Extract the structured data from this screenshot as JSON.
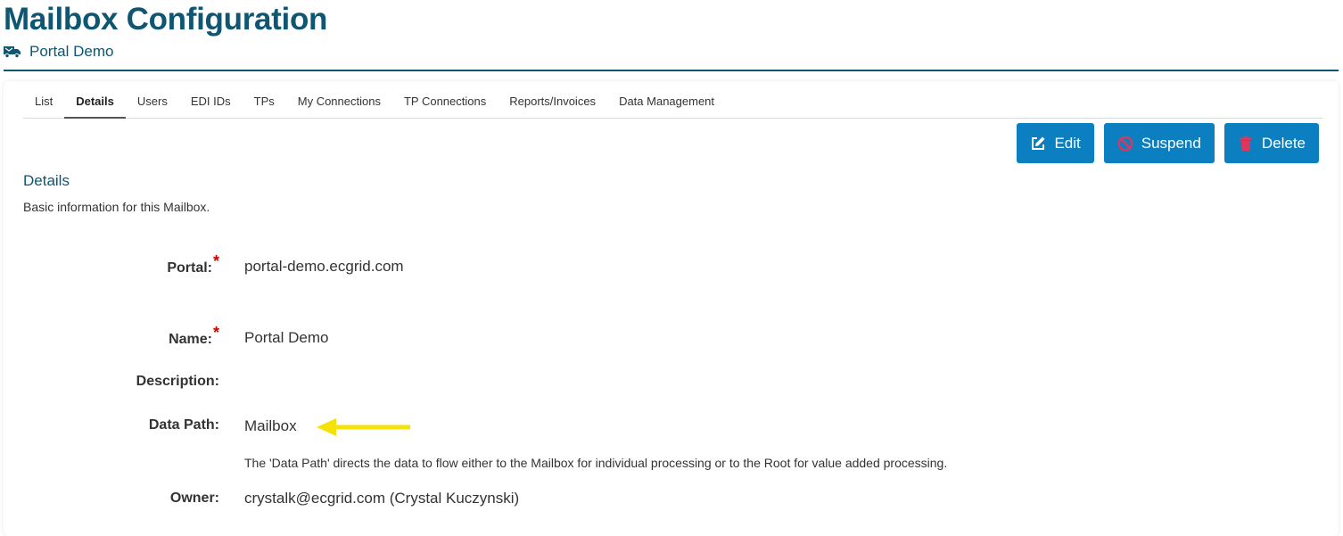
{
  "header": {
    "title": "Mailbox Configuration",
    "subtitle": "Portal Demo",
    "subtitle_icon": "mailbox-truck-icon",
    "accent_color": "#0e5672"
  },
  "tabs": [
    {
      "label": "List",
      "active": false
    },
    {
      "label": "Details",
      "active": true
    },
    {
      "label": "Users",
      "active": false
    },
    {
      "label": "EDI IDs",
      "active": false
    },
    {
      "label": "TPs",
      "active": false
    },
    {
      "label": "My Connections",
      "active": false
    },
    {
      "label": "TP Connections",
      "active": false
    },
    {
      "label": "Reports/Invoices",
      "active": false
    },
    {
      "label": "Data Management",
      "active": false
    }
  ],
  "actions": {
    "button_color": "#0b7fbf",
    "edit": {
      "label": "Edit",
      "icon": "edit-icon"
    },
    "suspend": {
      "label": "Suspend",
      "icon": "ban-icon"
    },
    "delete": {
      "label": "Delete",
      "icon": "trash-icon"
    }
  },
  "section": {
    "title": "Details",
    "description": "Basic information for this Mailbox."
  },
  "fields": {
    "portal": {
      "label": "Portal:",
      "required": "*",
      "value": "portal-demo.ecgrid.com"
    },
    "name": {
      "label": "Name:",
      "required": "*",
      "value": "Portal Demo"
    },
    "description": {
      "label": "Description:",
      "value": ""
    },
    "data_path": {
      "label": "Data Path:",
      "value": "Mailbox",
      "help": "The 'Data Path' directs the data to flow either to the Mailbox for individual processing or to the Root for value added processing.",
      "annotation_color": "#f5e20a"
    },
    "owner": {
      "label": "Owner:",
      "value": "crystalk@ecgrid.com (Crystal Kuczynski)"
    }
  }
}
